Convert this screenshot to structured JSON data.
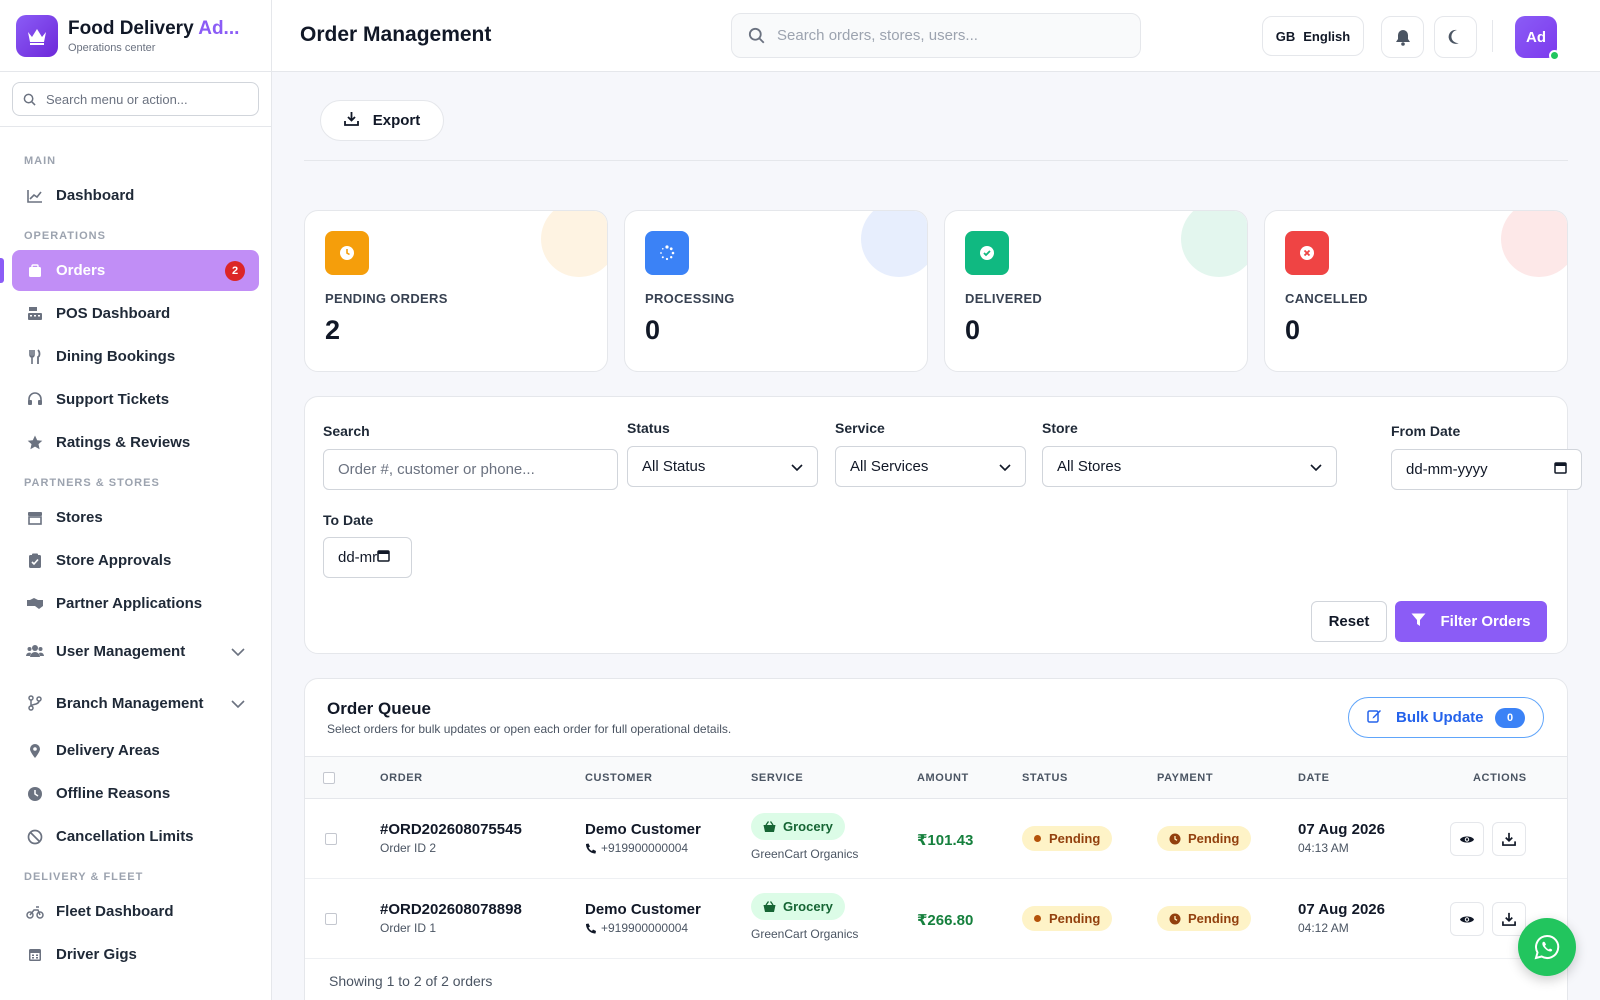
{
  "brand": {
    "title_main": "Food Delivery ",
    "title_accent": "Ad...",
    "subtitle": "Operations center"
  },
  "sidebar": {
    "search_placeholder": "Search menu or action...",
    "sections": {
      "main": "MAIN",
      "operations": "OPERATIONS",
      "partners": "PARTNERS & STORES",
      "fleet": "DELIVERY & FLEET"
    },
    "items": {
      "dashboard": "Dashboard",
      "orders": "Orders",
      "orders_badge": "2",
      "pos": "POS Dashboard",
      "dining": "Dining Bookings",
      "support": "Support Tickets",
      "ratings": "Ratings & Reviews",
      "stores": "Stores",
      "approvals": "Store Approvals",
      "partner_apps": "Partner Applications",
      "user_mgmt": "User Management",
      "branch_mgmt": "Branch Management",
      "delivery_areas": "Delivery Areas",
      "offline": "Offline Reasons",
      "cancellation": "Cancellation Limits",
      "fleet": "Fleet Dashboard",
      "gigs": "Driver Gigs"
    }
  },
  "header": {
    "title": "Order Management",
    "search_placeholder": "Search orders, stores, users...",
    "lang_code": "GB",
    "lang_label": "English",
    "avatar": "Ad"
  },
  "toolbar": {
    "export_label": "Export"
  },
  "stats": [
    {
      "label": "PENDING ORDERS",
      "value": "2",
      "color": "#f59e0b"
    },
    {
      "label": "PROCESSING",
      "value": "0",
      "color": "#3b82f6"
    },
    {
      "label": "DELIVERED",
      "value": "0",
      "color": "#10b981"
    },
    {
      "label": "CANCELLED",
      "value": "0",
      "color": "#ef4444"
    }
  ],
  "filters": {
    "search_label": "Search",
    "search_placeholder": "Order #, customer or phone...",
    "status_label": "Status",
    "status_value": "All Status",
    "service_label": "Service",
    "service_value": "All Services",
    "store_label": "Store",
    "store_value": "All Stores",
    "from_label": "From Date",
    "from_value": "dd-mm-yyyy",
    "to_label": "To Date",
    "to_value": "dd-mr",
    "reset_label": "Reset",
    "filter_label": "Filter Orders"
  },
  "queue": {
    "title": "Order Queue",
    "subtitle": "Select orders for bulk updates or open each order for full operational details.",
    "bulk_label": "Bulk Update",
    "bulk_count": "0",
    "columns": {
      "order": "ORDER",
      "customer": "CUSTOMER",
      "service": "SERVICE",
      "amount": "AMOUNT",
      "status": "STATUS",
      "payment": "PAYMENT",
      "date": "DATE",
      "actions": "ACTIONS"
    },
    "rows": [
      {
        "order_no": "#ORD202608075545",
        "order_id": "Order ID 2",
        "customer": "Demo Customer",
        "phone": "+919900000004",
        "service": "Grocery",
        "store": "GreenCart Organics",
        "amount": "₹101.43",
        "status": "Pending",
        "payment": "Pending",
        "date": "07 Aug 2026",
        "time": "04:13 AM"
      },
      {
        "order_no": "#ORD202608078898",
        "order_id": "Order ID 1",
        "customer": "Demo Customer",
        "phone": "+919900000004",
        "service": "Grocery",
        "store": "GreenCart Organics",
        "amount": "₹266.80",
        "status": "Pending",
        "payment": "Pending",
        "date": "07 Aug 2026",
        "time": "04:12 AM"
      }
    ],
    "showing": "Showing 1 to 2 of 2 orders"
  }
}
